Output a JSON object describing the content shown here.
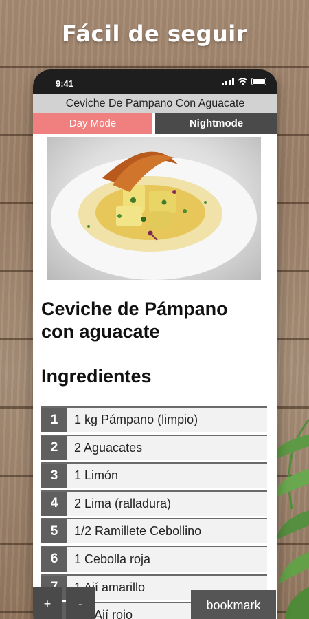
{
  "promo": {
    "headline": "Fácil de seguir"
  },
  "status_bar": {
    "time": "9:41"
  },
  "app": {
    "title": "Ceviche De Pampano Con Aguacate",
    "mode_day_label": "Day Mode",
    "mode_night_label": "Nightmode",
    "active_mode": "day",
    "colors": {
      "day_mode_bg": "#f08080",
      "night_mode_bg": "#4a4a4a",
      "title_bar_bg": "#d2d2d2"
    }
  },
  "recipe": {
    "title_line1": "Ceviche de Pámpano",
    "title_line2": "con aguacate",
    "ingredients_heading": "Ingredientes",
    "ingredients": [
      {
        "num": "1",
        "text": "1 kg Pámpano (limpio)"
      },
      {
        "num": "2",
        "text": "2 Aguacates"
      },
      {
        "num": "3",
        "text": "1 Limón"
      },
      {
        "num": "4",
        "text": "2 Lima (ralladura)"
      },
      {
        "num": "5",
        "text": "1/2 Ramillete Cebollino"
      },
      {
        "num": "6",
        "text": "1 Cebolla roja"
      },
      {
        "num": "7",
        "text": "1 Ají amarillo"
      },
      {
        "num": "8",
        "text": "1/2 Ají rojo"
      }
    ]
  },
  "controls": {
    "zoom_in_label": "+",
    "zoom_out_label": "-",
    "bookmark_label": "bookmark"
  }
}
